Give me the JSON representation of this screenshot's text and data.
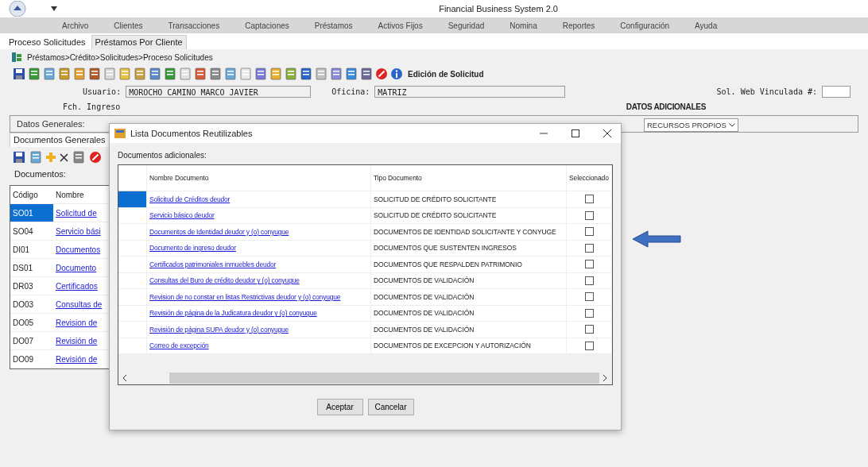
{
  "window": {
    "title": "Financial Business System 2.0"
  },
  "menu": [
    "Archivo",
    "Clientes",
    "Transacciones",
    "Captaciones",
    "Préstamos",
    "Activos Fijos",
    "Seguridad",
    "Nomina",
    "Reportes",
    "Configuración",
    "Ayuda"
  ],
  "tabs": [
    {
      "label": "Proceso Solicitudes",
      "selected": true
    },
    {
      "label": "Préstamos Por Cliente",
      "selected": false
    }
  ],
  "breadcrumb": "Préstamos>Crédito>Solicitudes>Proceso Solicitudes",
  "toolbar": {
    "label": "Edición de Solicitud"
  },
  "form": {
    "usuario_label": "Usuario:",
    "usuario": "MOROCHO CAMINO MARCO JAVIER",
    "oficina_label": "Oficina:",
    "oficina": "MATRIZ",
    "fecha_label": "Fch. Ingreso",
    "sol_web_label": "Sol. Web Vinculada #:"
  },
  "datos_generales": "Datos Generales:",
  "datos_adicionales": {
    "title": "DATOS ADICIONALES",
    "value": "RECURSOS PROPIOS"
  },
  "left_panel": {
    "tab": "Documentos Generales",
    "label": "Documentos:",
    "columns": [
      "Código",
      "Nombre"
    ],
    "rows": [
      {
        "code": "SO01",
        "name": "Solicitud de",
        "selected": true
      },
      {
        "code": "SO04",
        "name": "Servicio bási",
        "selected": false
      },
      {
        "code": "DI01",
        "name": "Documentos",
        "selected": false
      },
      {
        "code": "DS01",
        "name": "Documento",
        "selected": false
      },
      {
        "code": "DR03",
        "name": "Certificados",
        "selected": false
      },
      {
        "code": "DO03",
        "name": "Consultas de",
        "selected": false
      },
      {
        "code": "DO05",
        "name": "Revision de",
        "selected": false
      },
      {
        "code": "DO07",
        "name": "Revisión de",
        "selected": false
      },
      {
        "code": "DO09",
        "name": "Revisión de",
        "selected": false
      }
    ]
  },
  "dialog": {
    "title": "Lista Documentos Reutilizables",
    "label": "Documentos adicionales:",
    "columns": [
      "Nombre Documento",
      "Tipo Documento",
      "Seleccionado"
    ],
    "rows": [
      {
        "name": "Solicitud de Créditos deudor",
        "type": "SOLICITUD DE CRÉDITO SOLICITANTE",
        "checked": false,
        "selected": true
      },
      {
        "name": "Servicio básico deudor",
        "type": "SOLICITUD DE CRÉDITO SOLICITANTE",
        "checked": false,
        "selected": false
      },
      {
        "name": "Documentos de Identidad deudor y (o) conyugue",
        "type": "DOCUMENTOS DE IDENTIDAD SOLICITANTE Y CONYUGE",
        "checked": false,
        "selected": false
      },
      {
        "name": "Documento de ingreso deudor",
        "type": "DOCUMENTOS QUE SUSTENTEN INGRESOS",
        "checked": false,
        "selected": false
      },
      {
        "name": "Certificados patrimoniales inmuebles deudor",
        "type": "DOCUMENTOS QUE RESPALDEN PATRIMONIO",
        "checked": false,
        "selected": false
      },
      {
        "name": "Consultas del Buro de crédito deudor y (o) conyugue",
        "type": "DOCUMENTOS DE VALIDACIÓN",
        "checked": false,
        "selected": false
      },
      {
        "name": "Revision de no constar en listas Restrictivas deudor y (o) conyugue",
        "type": "DOCUMENTOS DE VALIDACIÓN",
        "checked": false,
        "selected": false
      },
      {
        "name": "Revisión de página de la Judicatura deudor y (o) conyugue",
        "type": "DOCUMENTOS DE VALIDACIÓN",
        "checked": false,
        "selected": false
      },
      {
        "name": "Revisión de página SUPA deudor y (o) conyugue",
        "type": "DOCUMENTOS DE VALIDACIÓN",
        "checked": false,
        "selected": false
      },
      {
        "name": "Correo de excepción",
        "type": "DOCUMENTOS DE EXCEPCION Y AUTORIZACIÓN",
        "checked": false,
        "selected": false
      }
    ],
    "buttons": [
      "Aceptar",
      "Cancelar"
    ]
  }
}
